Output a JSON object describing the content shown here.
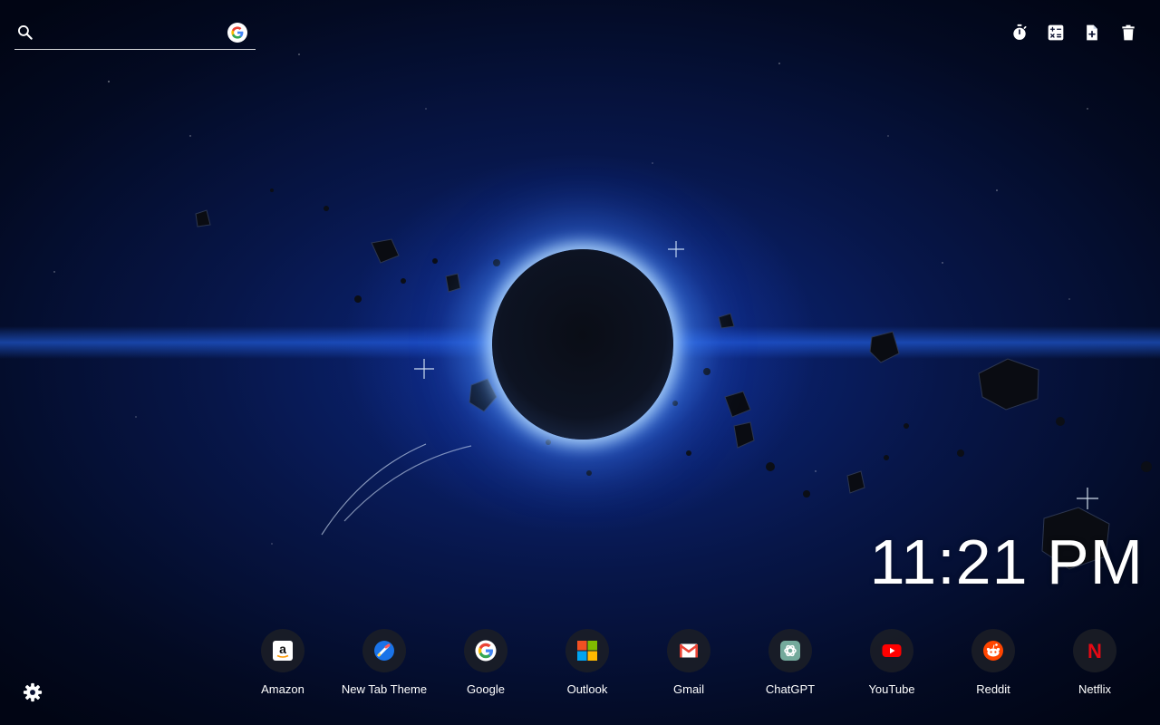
{
  "search": {
    "placeholder": "",
    "value": "",
    "icon": "search-icon",
    "engine_icon": "google-icon",
    "engine_letter": "G"
  },
  "toolbar": {
    "buttons": [
      {
        "name": "timer-button",
        "icon": "stopwatch-icon"
      },
      {
        "name": "calculator-button",
        "icon": "calculator-icon"
      },
      {
        "name": "new-note-button",
        "icon": "file-plus-icon"
      },
      {
        "name": "delete-button",
        "icon": "trash-icon"
      }
    ]
  },
  "clock": {
    "time": "11:21 PM"
  },
  "shortcuts": [
    {
      "label": "Amazon",
      "icon": "amazon-icon",
      "glyph": "a"
    },
    {
      "label": "New Tab Theme",
      "icon": "new-tab-theme-icon",
      "glyph": ""
    },
    {
      "label": "Google",
      "icon": "google-icon",
      "glyph": "G"
    },
    {
      "label": "Outlook",
      "icon": "microsoft-icon",
      "glyph": ""
    },
    {
      "label": "Gmail",
      "icon": "gmail-icon",
      "glyph": "M"
    },
    {
      "label": "ChatGPT",
      "icon": "chatgpt-icon",
      "glyph": ""
    },
    {
      "label": "YouTube",
      "icon": "youtube-icon",
      "glyph": ""
    },
    {
      "label": "Reddit",
      "icon": "reddit-icon",
      "glyph": ""
    },
    {
      "label": "Netflix",
      "icon": "netflix-icon",
      "glyph": "N"
    }
  ],
  "settings": {
    "icon": "gear-icon"
  },
  "colors": {
    "google_blue": "#4285F4",
    "google_red": "#EA4335",
    "google_yellow": "#FBBC05",
    "google_green": "#34A853",
    "youtube_red": "#FF0000",
    "reddit_orange": "#FF4500",
    "netflix_red": "#E50914",
    "chatgpt_teal": "#74AA9C"
  }
}
